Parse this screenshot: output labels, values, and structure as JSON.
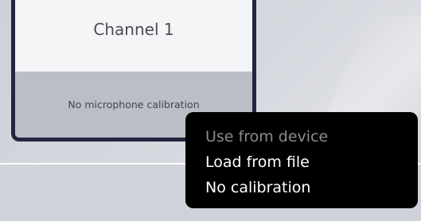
{
  "channel_card": {
    "title": "Channel 1",
    "calibration_status": "No microphone calibration"
  },
  "context_menu": {
    "items": [
      {
        "label": "Use from device",
        "enabled": false
      },
      {
        "label": "Load from file",
        "enabled": true
      },
      {
        "label": "No calibration",
        "enabled": true
      }
    ]
  },
  "colors": {
    "card_border": "#222640",
    "menu_background": "#000000",
    "menu_text": "#ffffff",
    "menu_text_disabled": "#8c8c8c"
  }
}
